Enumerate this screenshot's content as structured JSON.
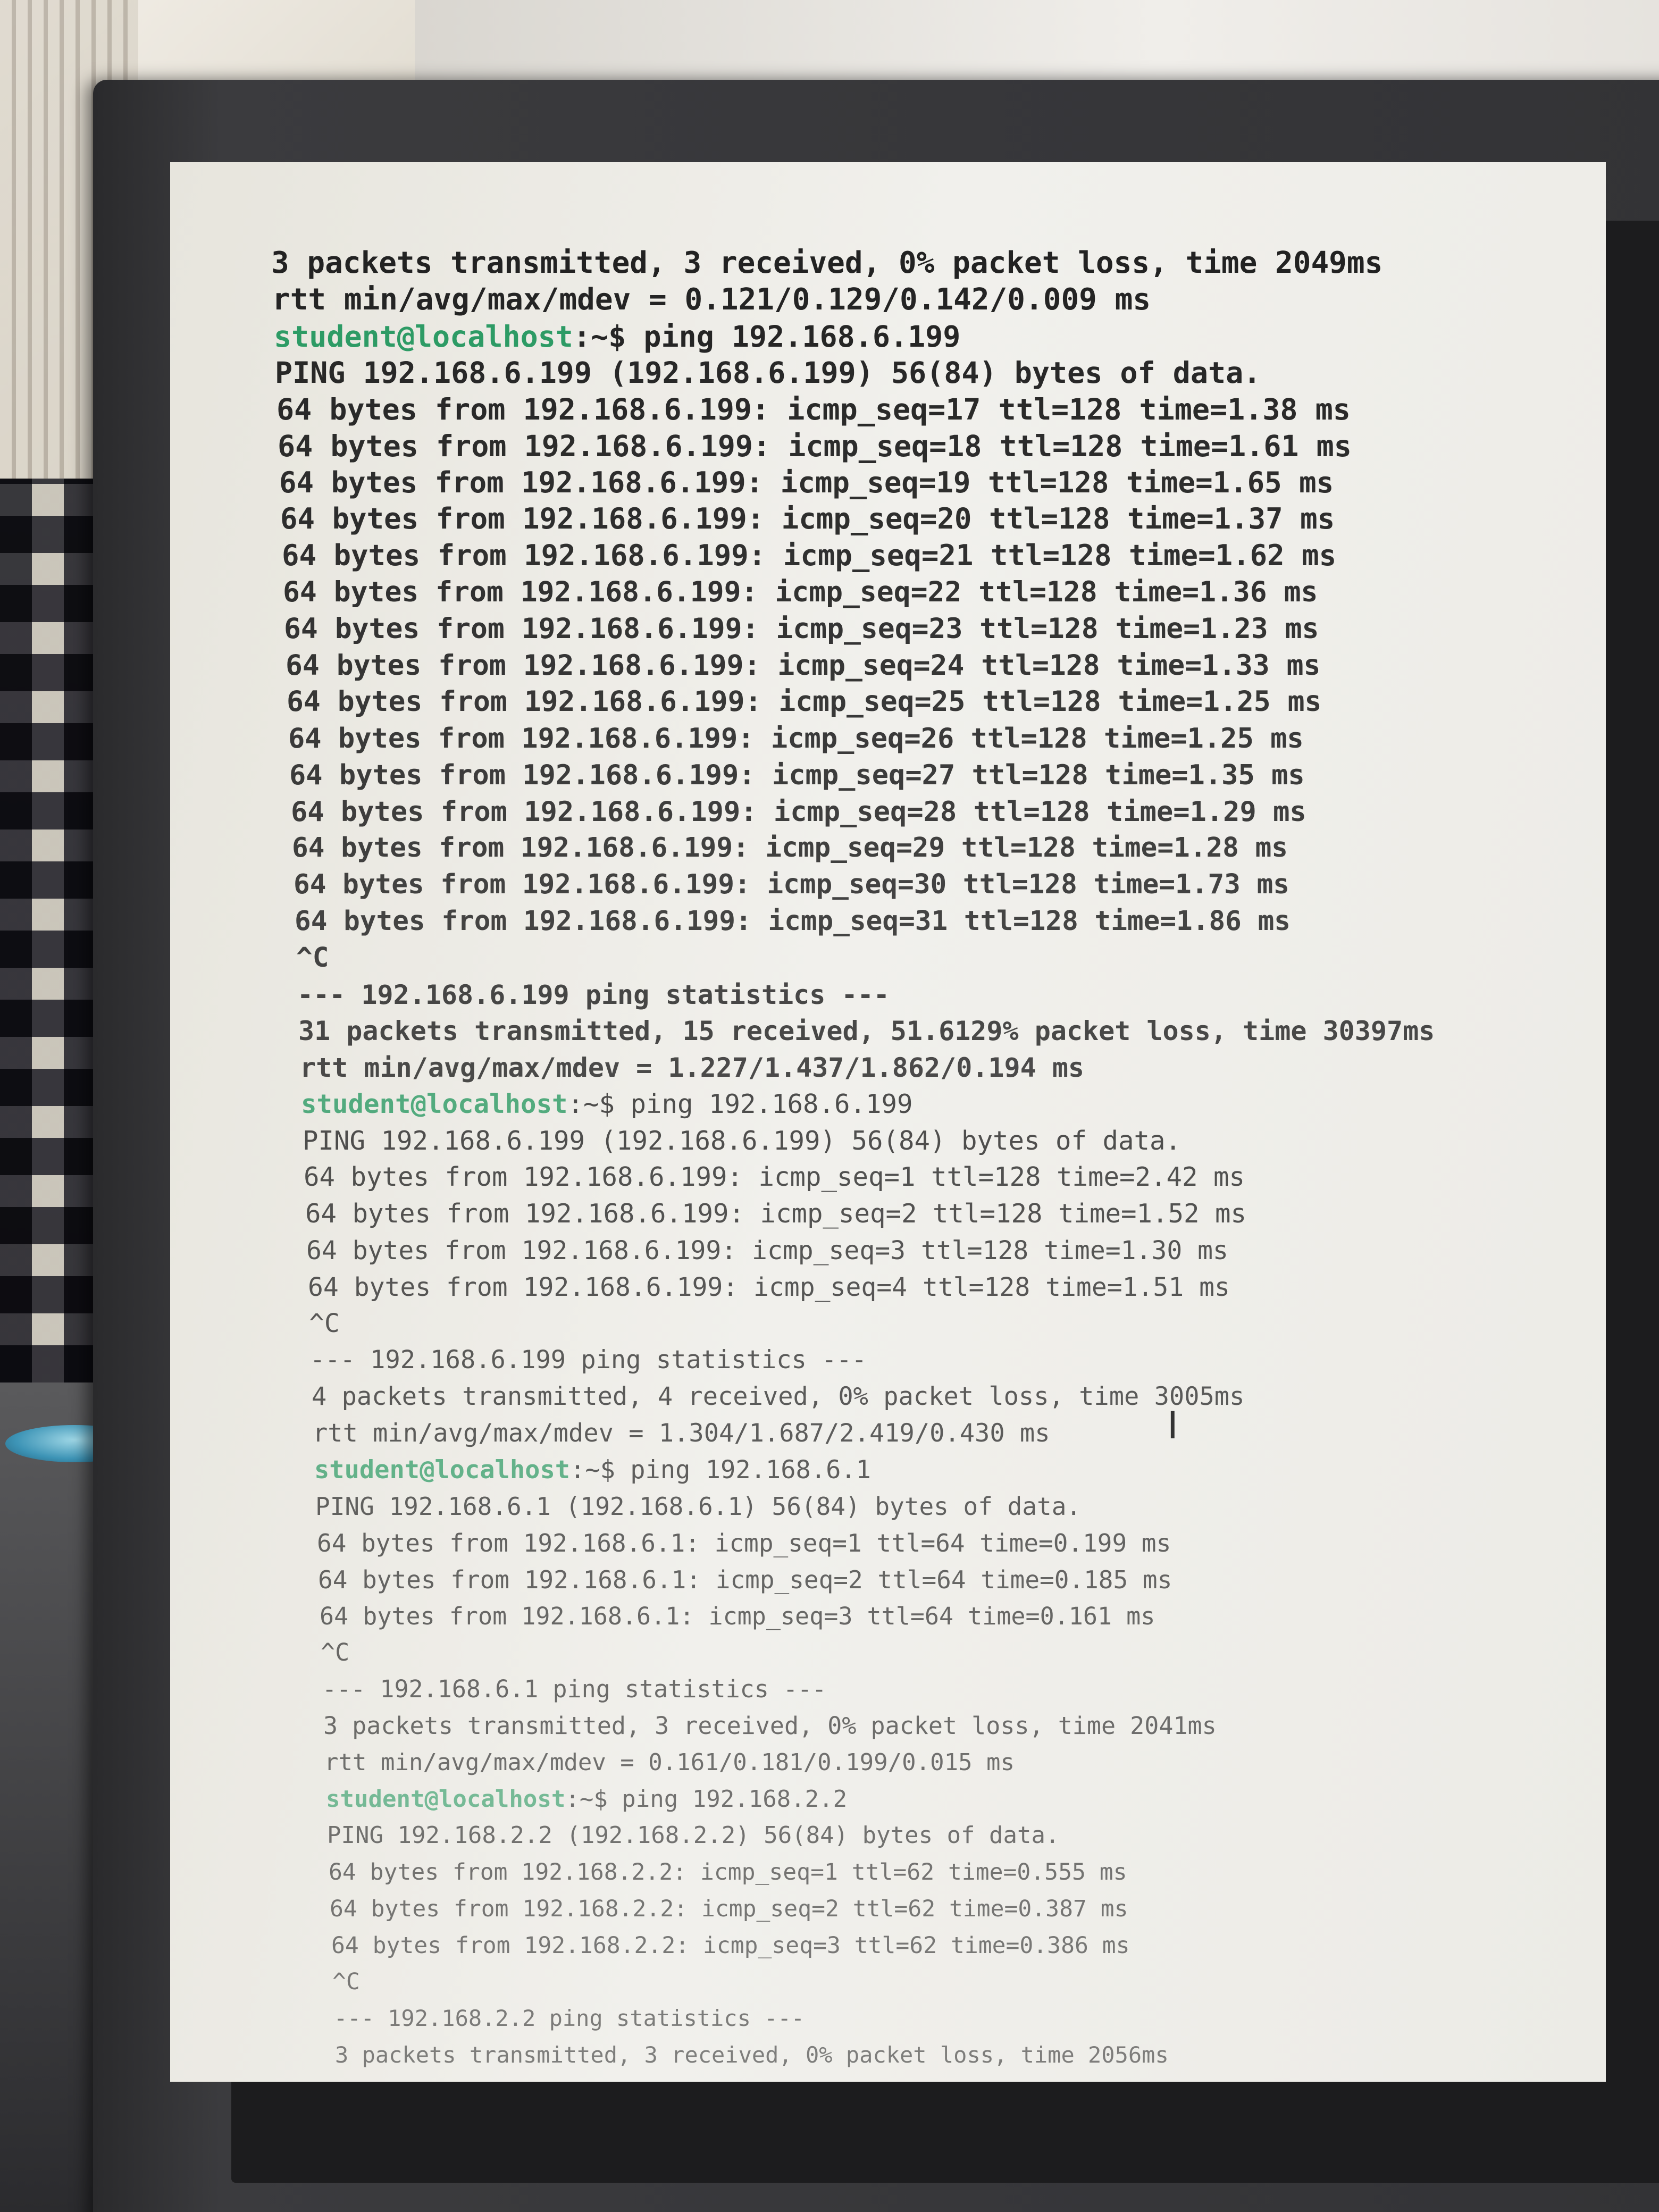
{
  "terminal": {
    "prompt_user": "student@localhost",
    "lines": [
      {
        "kind": "text",
        "text": "3 packets transmitted, 3 received, 0% packet loss, time 2049ms"
      },
      {
        "kind": "text",
        "text": "rtt min/avg/max/mdev = 0.121/0.129/0.142/0.009 ms"
      },
      {
        "kind": "prompt",
        "user": "student@localhost",
        "rest": ":~$ ping 192.168.6.199"
      },
      {
        "kind": "text",
        "text": "PING 192.168.6.199 (192.168.6.199) 56(84) bytes of data."
      },
      {
        "kind": "text",
        "text": "64 bytes from 192.168.6.199: icmp_seq=17 ttl=128 time=1.38 ms"
      },
      {
        "kind": "text",
        "text": "64 bytes from 192.168.6.199: icmp_seq=18 ttl=128 time=1.61 ms"
      },
      {
        "kind": "text",
        "text": "64 bytes from 192.168.6.199: icmp_seq=19 ttl=128 time=1.65 ms"
      },
      {
        "kind": "text",
        "text": "64 bytes from 192.168.6.199: icmp_seq=20 ttl=128 time=1.37 ms"
      },
      {
        "kind": "text",
        "text": "64 bytes from 192.168.6.199: icmp_seq=21 ttl=128 time=1.62 ms"
      },
      {
        "kind": "text",
        "text": "64 bytes from 192.168.6.199: icmp_seq=22 ttl=128 time=1.36 ms"
      },
      {
        "kind": "text",
        "text": "64 bytes from 192.168.6.199: icmp_seq=23 ttl=128 time=1.23 ms"
      },
      {
        "kind": "text",
        "text": "64 bytes from 192.168.6.199: icmp_seq=24 ttl=128 time=1.33 ms"
      },
      {
        "kind": "text",
        "text": "64 bytes from 192.168.6.199: icmp_seq=25 ttl=128 time=1.25 ms"
      },
      {
        "kind": "text",
        "text": "64 bytes from 192.168.6.199: icmp_seq=26 ttl=128 time=1.25 ms"
      },
      {
        "kind": "text",
        "text": "64 bytes from 192.168.6.199: icmp_seq=27 ttl=128 time=1.35 ms"
      },
      {
        "kind": "text",
        "text": "64 bytes from 192.168.6.199: icmp_seq=28 ttl=128 time=1.29 ms"
      },
      {
        "kind": "text",
        "text": "64 bytes from 192.168.6.199: icmp_seq=29 ttl=128 time=1.28 ms"
      },
      {
        "kind": "text",
        "text": "64 bytes from 192.168.6.199: icmp_seq=30 ttl=128 time=1.73 ms"
      },
      {
        "kind": "text",
        "text": "64 bytes from 192.168.6.199: icmp_seq=31 ttl=128 time=1.86 ms"
      },
      {
        "kind": "text",
        "text": "^C"
      },
      {
        "kind": "text",
        "text": "--- 192.168.6.199 ping statistics ---"
      },
      {
        "kind": "text",
        "text": "31 packets transmitted, 15 received, 51.6129% packet loss, time 30397ms"
      },
      {
        "kind": "text",
        "text": "rtt min/avg/max/mdev = 1.227/1.437/1.862/0.194 ms"
      },
      {
        "kind": "prompt",
        "user": "student@localhost",
        "rest": ":~$ ping 192.168.6.199"
      },
      {
        "kind": "text",
        "text": "PING 192.168.6.199 (192.168.6.199) 56(84) bytes of data."
      },
      {
        "kind": "text",
        "text": "64 bytes from 192.168.6.199: icmp_seq=1 ttl=128 time=2.42 ms"
      },
      {
        "kind": "text",
        "text": "64 bytes from 192.168.6.199: icmp_seq=2 ttl=128 time=1.52 ms"
      },
      {
        "kind": "text",
        "text": "64 bytes from 192.168.6.199: icmp_seq=3 ttl=128 time=1.30 ms"
      },
      {
        "kind": "text",
        "text": "64 bytes from 192.168.6.199: icmp_seq=4 ttl=128 time=1.51 ms"
      },
      {
        "kind": "text",
        "text": "^C"
      },
      {
        "kind": "text",
        "text": "--- 192.168.6.199 ping statistics ---"
      },
      {
        "kind": "text",
        "text": "4 packets transmitted, 4 received, 0% packet loss, time 3005ms"
      },
      {
        "kind": "text",
        "text": "rtt min/avg/max/mdev = 1.304/1.687/2.419/0.430 ms"
      },
      {
        "kind": "prompt",
        "user": "student@localhost",
        "rest": ":~$ ping 192.168.6.1"
      },
      {
        "kind": "text",
        "text": "PING 192.168.6.1 (192.168.6.1) 56(84) bytes of data."
      },
      {
        "kind": "text",
        "text": "64 bytes from 192.168.6.1: icmp_seq=1 ttl=64 time=0.199 ms"
      },
      {
        "kind": "text",
        "text": "64 bytes from 192.168.6.1: icmp_seq=2 ttl=64 time=0.185 ms"
      },
      {
        "kind": "text",
        "text": "64 bytes from 192.168.6.1: icmp_seq=3 ttl=64 time=0.161 ms"
      },
      {
        "kind": "text",
        "text": "^C"
      },
      {
        "kind": "text",
        "text": "--- 192.168.6.1 ping statistics ---"
      },
      {
        "kind": "text",
        "text": "3 packets transmitted, 3 received, 0% packet loss, time 2041ms"
      },
      {
        "kind": "text",
        "text": "rtt min/avg/max/mdev = 0.161/0.181/0.199/0.015 ms"
      },
      {
        "kind": "prompt",
        "user": "student@localhost",
        "rest": ":~$ ping 192.168.2.2"
      },
      {
        "kind": "text",
        "text": "PING 192.168.2.2 (192.168.2.2) 56(84) bytes of data."
      },
      {
        "kind": "text",
        "text": "64 bytes from 192.168.2.2: icmp_seq=1 ttl=62 time=0.555 ms"
      },
      {
        "kind": "text",
        "text": "64 bytes from 192.168.2.2: icmp_seq=2 ttl=62 time=0.387 ms"
      },
      {
        "kind": "text",
        "text": "64 bytes from 192.168.2.2: icmp_seq=3 ttl=62 time=0.386 ms"
      },
      {
        "kind": "text",
        "text": "^C"
      },
      {
        "kind": "text",
        "text": "--- 192.168.2.2 ping statistics ---"
      },
      {
        "kind": "text",
        "text": "3 packets transmitted, 3 received, 0% packet loss, time 2056ms"
      }
    ]
  },
  "colors": {
    "prompt": "#2a9a63",
    "text": "#222222",
    "screen_bg": "#f1f0ec"
  }
}
